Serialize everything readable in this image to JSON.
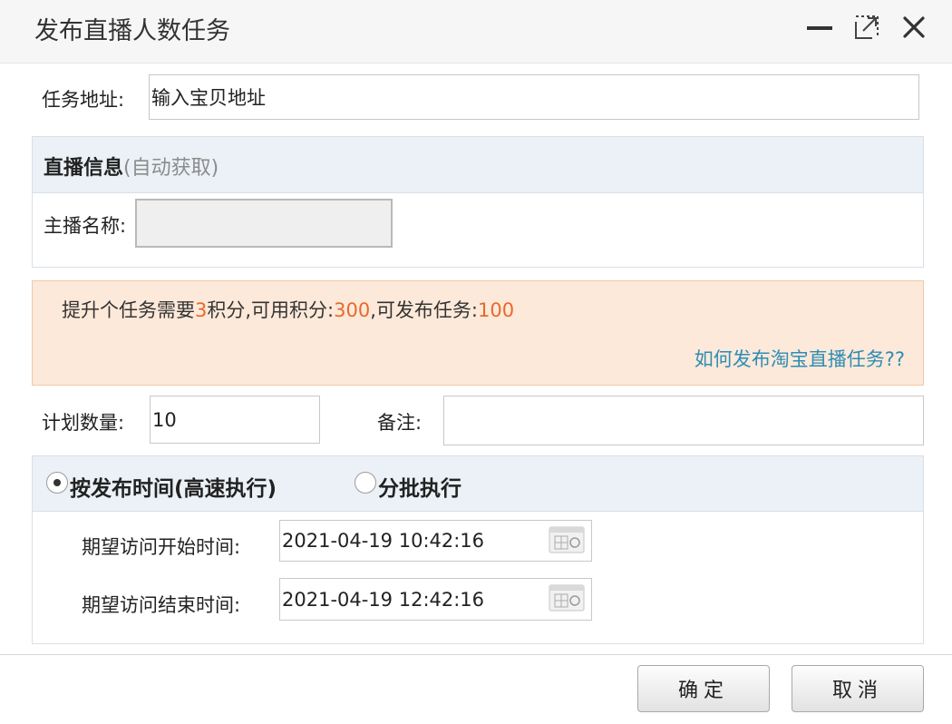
{
  "window": {
    "title": "发布直播人数任务"
  },
  "task_address": {
    "label": "任务地址:",
    "value": "输入宝贝地址"
  },
  "live_info": {
    "title": "直播信息",
    "subtitle": "(自动获取)",
    "anchor_label": "主播名称:",
    "anchor_value": ""
  },
  "notice": {
    "prefix": "提升个任务需要",
    "cost": "3",
    "mid1": "积分,可用积分:",
    "points": "300",
    "mid2": ",可发布任务:",
    "tasks": "100",
    "link": "如何发布淘宝直播任务??"
  },
  "plan": {
    "quantity_label": "计划数量:",
    "quantity_value": "10",
    "remark_label": "备注:",
    "remark_value": ""
  },
  "schedule": {
    "option_time": "按发布时间(高速执行)",
    "option_batch": "分批执行",
    "selected": "option_time",
    "start_label": "期望访问开始时间:",
    "start_value": "2021-04-19 10:42:16",
    "end_label": "期望访问结束时间:",
    "end_value": "2021-04-19 12:42:16"
  },
  "buttons": {
    "confirm": "确定",
    "cancel": "取消"
  },
  "colors": {
    "accent_orange": "#e8692b",
    "link_blue": "#2e8db5",
    "notice_bg": "#fde9d9",
    "panel_head_bg": "#ebf1f6"
  }
}
